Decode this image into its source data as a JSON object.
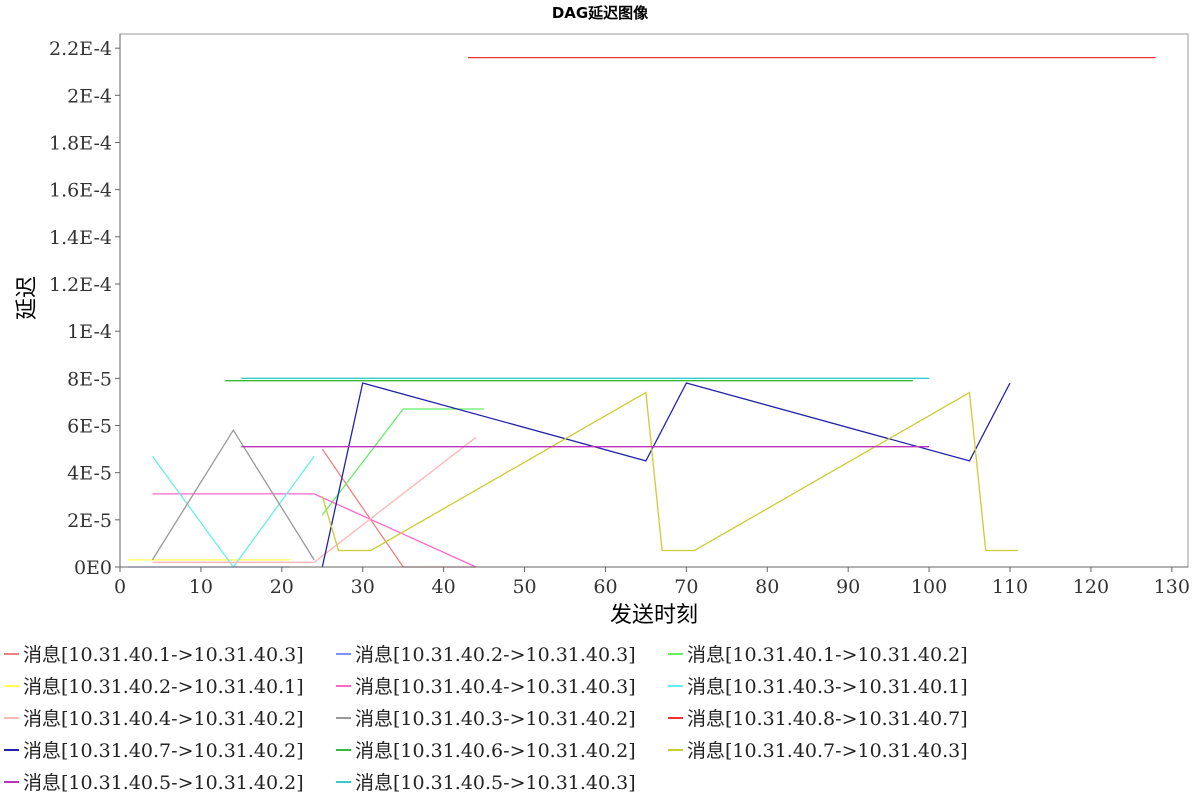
{
  "chart_data": {
    "type": "line",
    "title": "DAG延迟图像",
    "xlabel": "发送时刻",
    "ylabel": "延迟",
    "xlim": [
      0,
      132
    ],
    "ylim": [
      0,
      0.000226
    ],
    "x_ticks": [
      0,
      10,
      20,
      30,
      40,
      50,
      60,
      70,
      80,
      90,
      100,
      110,
      120,
      130
    ],
    "x_tick_labels": [
      "0",
      "10",
      "20",
      "30",
      "40",
      "50",
      "60",
      "70",
      "80",
      "90",
      "100",
      "110",
      "120",
      "130"
    ],
    "y_ticks": [
      0,
      2e-05,
      4e-05,
      6e-05,
      8e-05,
      0.0001,
      0.00012,
      0.00014,
      0.00016,
      0.00018,
      0.0002,
      0.00022
    ],
    "y_tick_labels": [
      "0E0",
      "2E-5",
      "4E-5",
      "6E-5",
      "8E-5",
      "1E-4",
      "1.2E-4",
      "1.4E-4",
      "1.6E-4",
      "1.8E-4",
      "2E-4",
      "2.2E-4"
    ],
    "grid": false,
    "legend_position": "bottom",
    "series": [
      {
        "name": "消息[10.31.40.1->10.31.40.3]",
        "color": "#f08080",
        "points": [
          [
            25,
            5e-05
          ],
          [
            35,
            0.0
          ],
          [
            44,
            0.0
          ]
        ]
      },
      {
        "name": "消息[10.31.40.2->10.31.40.3]",
        "color": "#7f8fff",
        "points": [
          [
            1,
            0.0
          ],
          [
            21,
            0.0
          ]
        ]
      },
      {
        "name": "消息[10.31.40.1->10.31.40.2]",
        "color": "#66ee66",
        "points": [
          [
            25,
            2.2e-05
          ],
          [
            35,
            6.7e-05
          ],
          [
            45,
            6.7e-05
          ]
        ]
      },
      {
        "name": "消息[10.31.40.2->10.31.40.1]",
        "color": "#ffff55",
        "points": [
          [
            1,
            3e-06
          ],
          [
            21,
            3e-06
          ]
        ]
      },
      {
        "name": "消息[10.31.40.4->10.31.40.3]",
        "color": "#ff66cc",
        "points": [
          [
            4,
            3.1e-05
          ],
          [
            24,
            3.1e-05
          ],
          [
            44,
            0.0
          ]
        ]
      },
      {
        "name": "消息[10.31.40.3->10.31.40.1]",
        "color": "#66eeee",
        "points": [
          [
            4,
            4.7e-05
          ],
          [
            14,
            0.0
          ],
          [
            24,
            4.7e-05
          ]
        ]
      },
      {
        "name": "消息[10.31.40.4->10.31.40.2]",
        "color": "#ffb6b6",
        "points": [
          [
            4,
            2e-06
          ],
          [
            24,
            2e-06
          ],
          [
            44,
            5.5e-05
          ]
        ]
      },
      {
        "name": "消息[10.31.40.3->10.31.40.2]",
        "color": "#999999",
        "points": [
          [
            4,
            3e-06
          ],
          [
            14,
            5.8e-05
          ],
          [
            24,
            3e-06
          ]
        ]
      },
      {
        "name": "消息[10.31.40.8->10.31.40.7]",
        "color": "#ee3333",
        "points": [
          [
            43,
            0.000216
          ],
          [
            128,
            0.000216
          ]
        ]
      },
      {
        "name": "消息[10.31.40.7->10.31.40.2]",
        "color": "#2222aa",
        "points": [
          [
            25,
            0.0
          ],
          [
            30,
            7.8e-05
          ],
          [
            65,
            4.5e-05
          ],
          [
            70,
            7.8e-05
          ],
          [
            105,
            4.5e-05
          ],
          [
            110,
            7.8e-05
          ]
        ]
      },
      {
        "name": "消息[10.31.40.6->10.31.40.2]",
        "color": "#33bb33",
        "points": [
          [
            13,
            7.9e-05
          ],
          [
            98,
            7.9e-05
          ]
        ]
      },
      {
        "name": "消息[10.31.40.7->10.31.40.3]",
        "color": "#cccc33",
        "points": [
          [
            25,
            3e-05
          ],
          [
            27,
            7e-06
          ],
          [
            31,
            7e-06
          ],
          [
            65,
            7.4e-05
          ],
          [
            67,
            7e-06
          ],
          [
            71,
            7e-06
          ],
          [
            105,
            7.4e-05
          ],
          [
            107,
            7e-06
          ],
          [
            111,
            7e-06
          ]
        ]
      },
      {
        "name": "消息[10.31.40.5->10.31.40.2]",
        "color": "#bb33bb",
        "points": [
          [
            15,
            5.1e-05
          ],
          [
            100,
            5.1e-05
          ]
        ]
      },
      {
        "name": "消息[10.31.40.5->10.31.40.3]",
        "color": "#33cccc",
        "points": [
          [
            15,
            8e-05
          ],
          [
            100,
            8e-05
          ]
        ]
      }
    ]
  }
}
